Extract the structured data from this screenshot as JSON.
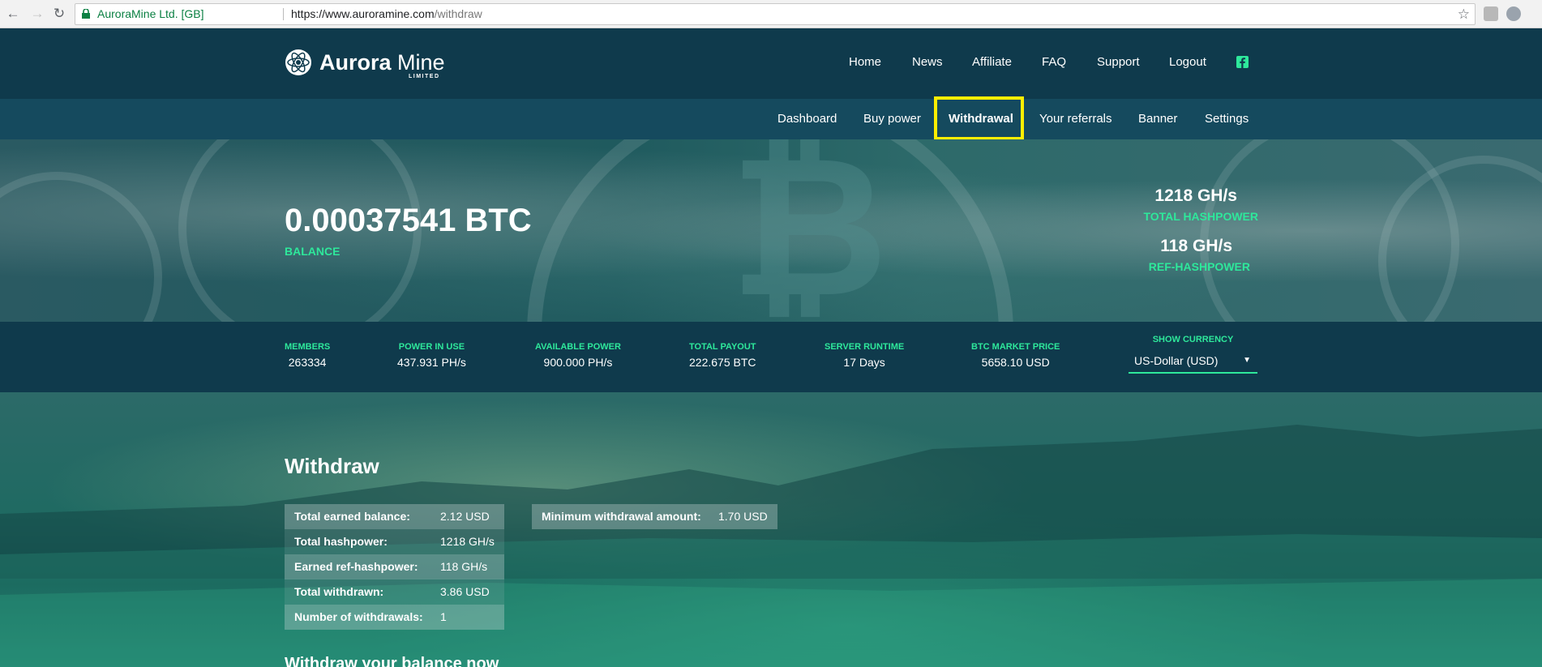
{
  "browser": {
    "site_identity": "AuroraMine Ltd. [GB]",
    "url_host": "https://www.auroramine.com",
    "url_path": "/withdraw",
    "icons": [
      "back-icon",
      "forward-icon",
      "reload-icon",
      "lock-icon",
      "star-icon"
    ]
  },
  "brand": {
    "name_bold": "Aurora",
    "name_light": " Mine",
    "tagline": "LIMITED"
  },
  "top_nav": [
    "Home",
    "News",
    "Affiliate",
    "FAQ",
    "Support",
    "Logout"
  ],
  "sub_nav": {
    "items": [
      "Dashboard",
      "Buy power",
      "Withdrawal",
      "Your referrals",
      "Banner",
      "Settings"
    ],
    "active": "Withdrawal"
  },
  "hero": {
    "balance_value": "0.00037541 BTC",
    "balance_label": "BALANCE",
    "total_hashpower_value": "1218 GH/s",
    "total_hashpower_label": "TOTAL HASHPOWER",
    "ref_hashpower_value": "118 GH/s",
    "ref_hashpower_label": "REF-HASHPOWER"
  },
  "stats": [
    {
      "label": "MEMBERS",
      "value": "263334"
    },
    {
      "label": "POWER IN USE",
      "value": "437.931 PH/s"
    },
    {
      "label": "AVAILABLE POWER",
      "value": "900.000 PH/s"
    },
    {
      "label": "TOTAL PAYOUT",
      "value": "222.675 BTC"
    },
    {
      "label": "SERVER RUNTIME",
      "value": "17 Days"
    },
    {
      "label": "BTC MARKET PRICE",
      "value": "5658.10 USD"
    }
  ],
  "currency": {
    "label": "SHOW CURRENCY",
    "selected": "US-Dollar (USD)"
  },
  "withdraw": {
    "title": "Withdraw",
    "rows": [
      {
        "key": "Total earned balance:",
        "value": "2.12 USD"
      },
      {
        "key": "Total hashpower:",
        "value": "1218 GH/s"
      },
      {
        "key": "Earned ref-hashpower:",
        "value": "118 GH/s"
      },
      {
        "key": "Total withdrawn:",
        "value": "3.86 USD"
      },
      {
        "key": "Number of withdrawals:",
        "value": "1"
      }
    ],
    "minimum": {
      "key": "Minimum withdrawal amount:",
      "value": "1.70 USD"
    },
    "subtitle": "Withdraw your balance now"
  },
  "colors": {
    "accent": "#2ee89b",
    "header_bg": "#0f3a4c",
    "subnav_bg": "#154a5e",
    "highlight": "#ffee00"
  }
}
